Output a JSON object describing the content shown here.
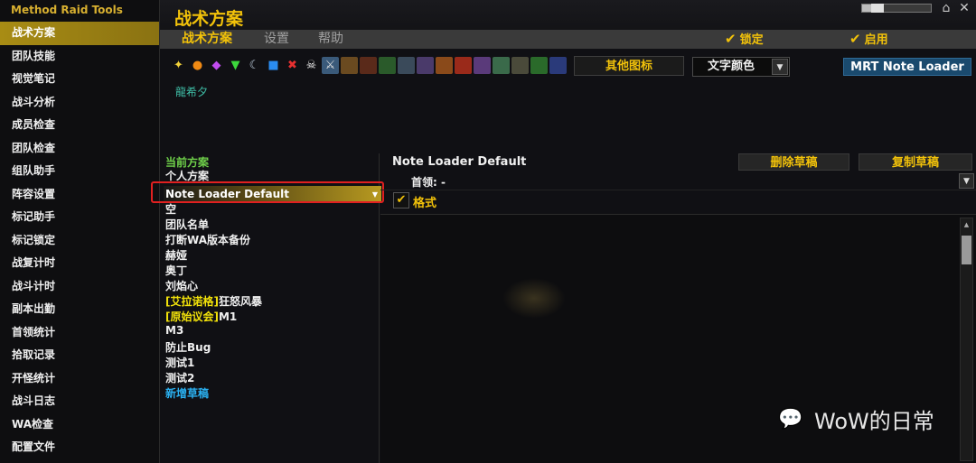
{
  "sidebar": {
    "title": "Method Raid Tools",
    "items": [
      {
        "label": "战术方案",
        "active": true
      },
      {
        "label": "团队技能"
      },
      {
        "label": "视觉笔记"
      },
      {
        "label": "战斗分析"
      },
      {
        "label": "成员检查"
      },
      {
        "label": "团队检查"
      },
      {
        "label": "组队助手"
      },
      {
        "label": "阵容设置"
      },
      {
        "label": "标记助手"
      },
      {
        "label": "标记锁定"
      },
      {
        "label": "战复计时"
      },
      {
        "label": "战斗计时"
      },
      {
        "label": "副本出勤"
      },
      {
        "label": "首领统计"
      },
      {
        "label": "拾取记录"
      },
      {
        "label": "开怪统计"
      },
      {
        "label": "战斗日志"
      },
      {
        "label": "WA检查"
      },
      {
        "label": "配置文件"
      }
    ]
  },
  "header": {
    "title": "战术方案",
    "scale_fraction": 0.32,
    "home_icon": "home-icon",
    "close_icon": "close-icon"
  },
  "tabs": [
    {
      "label": "战术方案",
      "active": true
    },
    {
      "label": "设置"
    },
    {
      "label": "帮助"
    }
  ],
  "checks": {
    "lock_label": "锁定",
    "enable_label": "启用"
  },
  "toolbar": {
    "icon_names": [
      "star-marker-icon",
      "circle-marker-icon",
      "diamond-marker-icon",
      "triangle-marker-icon",
      "moon-marker-icon",
      "square-marker-icon",
      "cross-marker-icon",
      "skull-marker-icon",
      "sword-icon",
      "class-icon-1",
      "class-icon-2",
      "class-icon-3",
      "class-icon-4",
      "class-icon-5",
      "class-icon-6",
      "class-icon-7",
      "class-icon-8",
      "class-icon-9",
      "class-icon-10",
      "class-icon-11",
      "class-icon-12"
    ],
    "other_icons_label": "其他图标",
    "text_color_label": "文字颜色",
    "loader_label": "MRT Note Loader",
    "character_name": "龍希夕"
  },
  "list": {
    "current_label": "当前方案",
    "personal_label": "个人方案",
    "selected_draft": "Note Loader Default",
    "items": [
      {
        "label": "空"
      },
      {
        "label": "团队名单"
      },
      {
        "label": "打断WA版本备份"
      },
      {
        "label": "赫娅"
      },
      {
        "label": "奥丁"
      },
      {
        "label": "刘焰心"
      },
      {
        "prefix": "[艾拉诺格]",
        "label": "狂怒风暴"
      },
      {
        "prefix": "[原始议会]",
        "label": "M1"
      },
      {
        "label": "M3"
      },
      {
        "label": "防止Bug"
      },
      {
        "label": "测试1"
      },
      {
        "label": "测试2"
      }
    ],
    "new_draft_label": "新增草稿"
  },
  "note": {
    "title": "Note Loader Default",
    "delete_label": "删除草稿",
    "copy_label": "复制草稿",
    "boss_label": "首领:",
    "boss_value": "-",
    "format_label": "格式",
    "format_checked": true
  },
  "watermark": {
    "text": "WoW的日常",
    "icon": "wechat-icon"
  },
  "colors": {
    "accent": "#f2c20a",
    "sidebar_active": "#a88c14",
    "list_header": "#6fd04a",
    "new_draft": "#2ab0f0",
    "highlight_box": "#e02020",
    "loader_button": "#1a4a6e"
  }
}
